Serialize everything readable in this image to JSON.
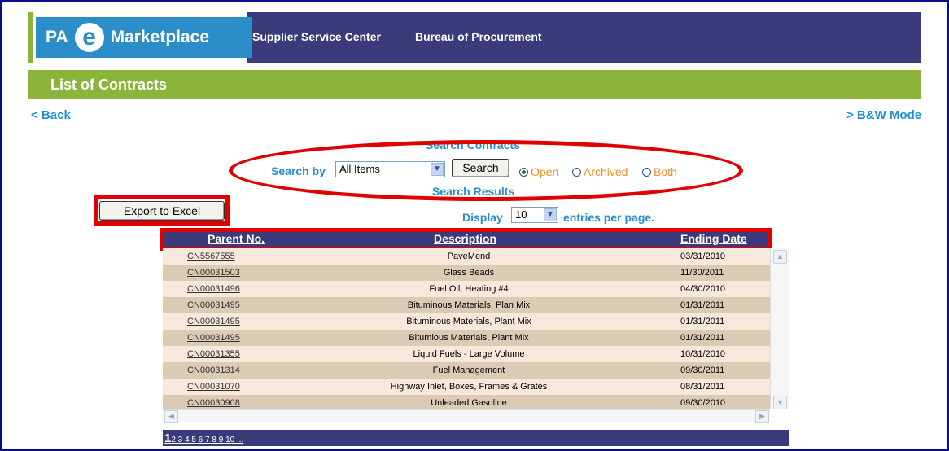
{
  "header": {
    "logo_pa": "PA",
    "logo_e": "e",
    "logo_text": "Marketplace",
    "link1": "Supplier Service Center",
    "link2": "Bureau of Procurement"
  },
  "title": "List of Contracts",
  "nav": {
    "back": "< Back",
    "bw_mode": "> B&W Mode"
  },
  "search": {
    "heading": "Search Contracts",
    "label": "Search by",
    "select_value": "All Items",
    "button": "Search",
    "options": [
      {
        "label": "Open",
        "selected": true
      },
      {
        "label": "Archived",
        "selected": false
      },
      {
        "label": "Both",
        "selected": false
      }
    ]
  },
  "results": {
    "heading": "Search Results",
    "export": "Export to Excel",
    "display_label": "Display",
    "display_value": "10",
    "per_page_label": "entries per page."
  },
  "table": {
    "columns": [
      "Parent No.",
      "Description",
      "Ending Date"
    ],
    "rows": [
      {
        "parent": "CN5567555",
        "description": "PaveMend",
        "ending": "03/31/2010"
      },
      {
        "parent": "CN00031503",
        "description": "Glass Beads",
        "ending": "11/30/2011"
      },
      {
        "parent": "CN00031496",
        "description": "Fuel Oil, Heating #4",
        "ending": "04/30/2010"
      },
      {
        "parent": "CN00031495",
        "description": "Bituminous Materials, Plan Mix",
        "ending": "01/31/2011"
      },
      {
        "parent": "CN00031495",
        "description": "Bituminous Materials, Plant Mix",
        "ending": "01/31/2011"
      },
      {
        "parent": "CN00031495",
        "description": "Bitumious Materials, Plant Mix",
        "ending": "01/31/2011"
      },
      {
        "parent": "CN00031355",
        "description": "Liquid Fuels - Large Volume",
        "ending": "10/31/2010"
      },
      {
        "parent": "CN00031314",
        "description": "Fuel Management",
        "ending": "09/30/2011"
      },
      {
        "parent": "CN00031070",
        "description": "Highway Inlet, Boxes, Frames & Grates",
        "ending": "08/31/2011"
      },
      {
        "parent": "CN00030908",
        "description": "Unleaded Gasoline",
        "ending": "09/30/2010"
      }
    ]
  },
  "pager": {
    "current": "1",
    "pages": "2 3 4 5 6 7 8 9 10 ..."
  },
  "colors": {
    "header_bg": "#3b3a7a",
    "accent_green": "#8db43a",
    "accent_blue": "#2b8ec8",
    "row_light": "#f8e8dc",
    "row_dark": "#dccbb4",
    "highlight_red": "#e00000",
    "radio_orange": "#f08f2a"
  }
}
